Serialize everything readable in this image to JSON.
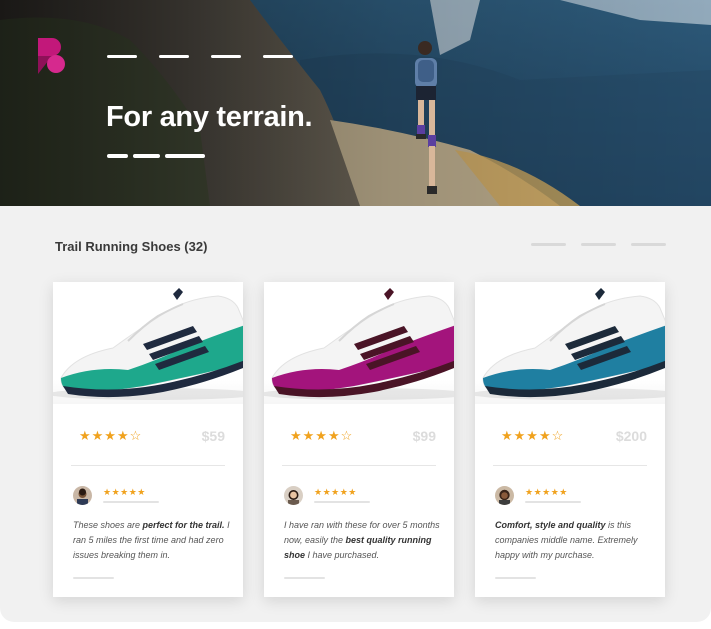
{
  "hero": {
    "title": "For any terrain.",
    "nav_count": 4
  },
  "catalog": {
    "title": "Trail Running Shoes (32)"
  },
  "colors": {
    "brand": "#c2187a",
    "star": "#f0a21e"
  },
  "products": [
    {
      "color": "#1ea88c",
      "stripe": "#1f2a3f",
      "rating": "★★★★☆",
      "price": "$59",
      "review_stars": "★★★★★",
      "review": {
        "a": "These shoes are ",
        "b": "perfect for the trail.",
        "c": " I ran 5 miles the first time and had zero issues breaking them in."
      }
    },
    {
      "color": "#a3147c",
      "stripe": "#4a1426",
      "rating": "★★★★☆",
      "price": "$99",
      "review_stars": "★★★★★",
      "review": {
        "a": "I have ran with these for over 5 months now, easily the ",
        "b": "best quality running shoe",
        "c": " I have purchased."
      }
    },
    {
      "color": "#1f7fa1",
      "stripe": "#1c2a3a",
      "rating": "★★★★☆",
      "price": "$200",
      "review_stars": "★★★★★",
      "review": {
        "a": "",
        "b": "Comfort, style and quality",
        "c": " is this companies middle name. Extremely happy with my purchase."
      }
    }
  ]
}
